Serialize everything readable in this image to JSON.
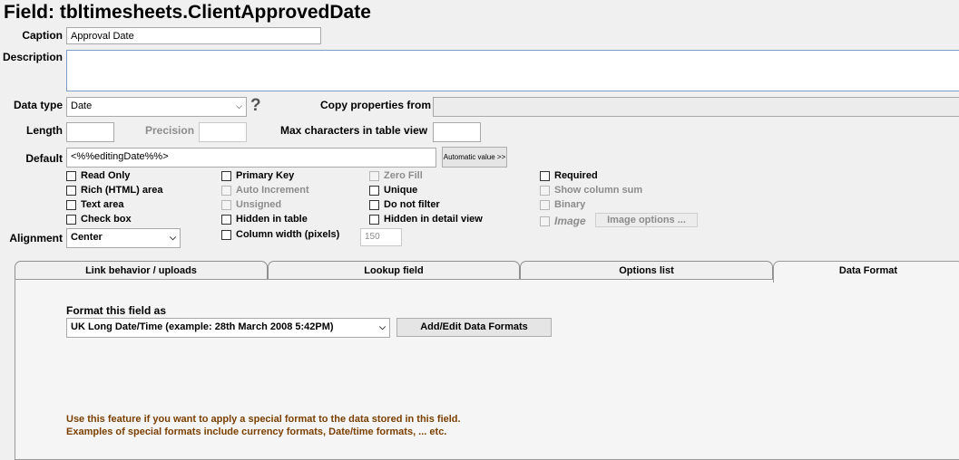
{
  "header": {
    "title": "Field: tbltimesheets.ClientApprovedDate"
  },
  "form": {
    "caption_label": "Caption",
    "caption_value": "Approval Date",
    "description_label": "Description",
    "description_value": "",
    "datatype_label": "Data type",
    "datatype_value": "Date",
    "help_glyph": "?",
    "copy_props_label": "Copy properties from",
    "copy_props_value": "",
    "length_label": "Length",
    "length_value": "",
    "precision_label": "Precision",
    "precision_value": "",
    "maxchars_label": "Max characters in table view",
    "maxchars_value": "",
    "default_label": "Default",
    "default_value": "<%%editingDate%%>",
    "auto_value_button": "Automatic value >>",
    "alignment_label": "Alignment",
    "alignment_value": "Center",
    "column_width_value": "150",
    "image_options_button": "Image options ..."
  },
  "checkboxes": {
    "read_only": "Read Only",
    "rich_html": "Rich (HTML) area",
    "text_area": "Text area",
    "check_box": "Check box",
    "primary_key": "Primary Key",
    "auto_increment": "Auto Increment",
    "unsigned": "Unsigned",
    "hidden_in_table": "Hidden in table",
    "column_width": "Column width (pixels)",
    "zero_fill": "Zero Fill",
    "unique": "Unique",
    "do_not_filter": "Do not filter",
    "hidden_in_detail": "Hidden in detail view",
    "required": "Required",
    "show_column_sum": "Show column sum",
    "binary": "Binary",
    "image": "Image"
  },
  "tabs": [
    {
      "label": "Link behavior / uploads"
    },
    {
      "label": "Lookup field"
    },
    {
      "label": "Options list"
    },
    {
      "label": "Data Format",
      "active": true
    }
  ],
  "data_format": {
    "format_label": "Format this field as",
    "format_value": "UK Long Date/Time (example: 28th March 2008 5:42PM)",
    "add_edit_button": "Add/Edit Data Formats",
    "note_line1": "Use this feature if you want to apply a special format to the data stored in this field.",
    "note_line2": "Examples of special formats include currency formats, Date/time formats, ... etc."
  },
  "colors": {
    "note_text": "#7b3f00",
    "background": "#f0f0f0"
  }
}
